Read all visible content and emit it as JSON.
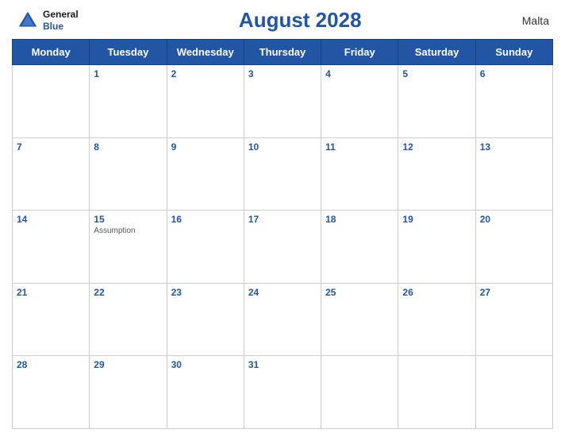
{
  "header": {
    "logo_general": "General",
    "logo_blue": "Blue",
    "title": "August 2028",
    "country": "Malta"
  },
  "weekdays": [
    "Monday",
    "Tuesday",
    "Wednesday",
    "Thursday",
    "Friday",
    "Saturday",
    "Sunday"
  ],
  "rows": [
    [
      {
        "day": "",
        "holiday": ""
      },
      {
        "day": "1",
        "holiday": ""
      },
      {
        "day": "2",
        "holiday": ""
      },
      {
        "day": "3",
        "holiday": ""
      },
      {
        "day": "4",
        "holiday": ""
      },
      {
        "day": "5",
        "holiday": ""
      },
      {
        "day": "6",
        "holiday": ""
      }
    ],
    [
      {
        "day": "7",
        "holiday": ""
      },
      {
        "day": "8",
        "holiday": ""
      },
      {
        "day": "9",
        "holiday": ""
      },
      {
        "day": "10",
        "holiday": ""
      },
      {
        "day": "11",
        "holiday": ""
      },
      {
        "day": "12",
        "holiday": ""
      },
      {
        "day": "13",
        "holiday": ""
      }
    ],
    [
      {
        "day": "14",
        "holiday": ""
      },
      {
        "day": "15",
        "holiday": "Assumption"
      },
      {
        "day": "16",
        "holiday": ""
      },
      {
        "day": "17",
        "holiday": ""
      },
      {
        "day": "18",
        "holiday": ""
      },
      {
        "day": "19",
        "holiday": ""
      },
      {
        "day": "20",
        "holiday": ""
      }
    ],
    [
      {
        "day": "21",
        "holiday": ""
      },
      {
        "day": "22",
        "holiday": ""
      },
      {
        "day": "23",
        "holiday": ""
      },
      {
        "day": "24",
        "holiday": ""
      },
      {
        "day": "25",
        "holiday": ""
      },
      {
        "day": "26",
        "holiday": ""
      },
      {
        "day": "27",
        "holiday": ""
      }
    ],
    [
      {
        "day": "28",
        "holiday": ""
      },
      {
        "day": "29",
        "holiday": ""
      },
      {
        "day": "30",
        "holiday": ""
      },
      {
        "day": "31",
        "holiday": ""
      },
      {
        "day": "",
        "holiday": ""
      },
      {
        "day": "",
        "holiday": ""
      },
      {
        "day": "",
        "holiday": ""
      }
    ]
  ]
}
